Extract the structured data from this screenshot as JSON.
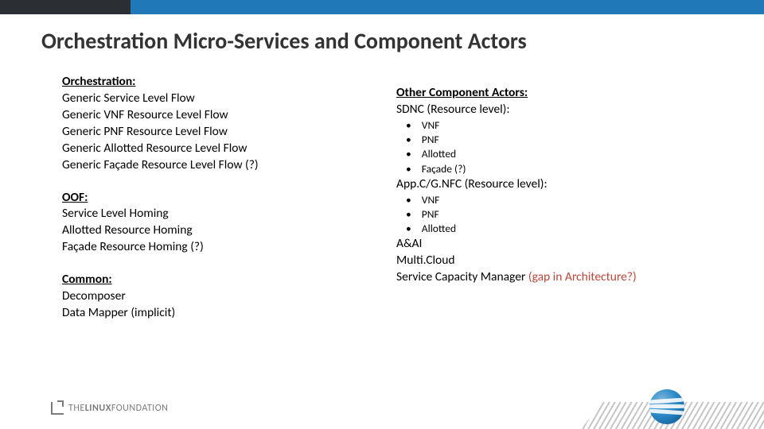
{
  "title": "Orchestration Micro-Services and Component Actors",
  "left": {
    "orch": {
      "head": "Orchestration:",
      "l1": "Generic Service Level Flow",
      "l2": "Generic VNF Resource Level Flow",
      "l3": "Generic PNF Resource Level Flow",
      "l4": "Generic Allotted Resource Level Flow",
      "l5": "Generic Façade Resource Level Flow (?)"
    },
    "oof": {
      "head": "OOF:",
      "l1": "Service Level Homing",
      "l2": "Allotted Resource Homing",
      "l3": "Façade Resource Homing (?)"
    },
    "common": {
      "head": "Common:",
      "l1": "Decomposer",
      "l2": "Data Mapper (implicit)"
    }
  },
  "right": {
    "head": "Other Component Actors:",
    "sdnc": {
      "head": "SDNC (Resource level):",
      "b1": "VNF",
      "b2": "PNF",
      "b3": "Allotted",
      "b4": "Façade (?)"
    },
    "appc": {
      "head": "App.C/G.NFC (Resource level):",
      "b1": "VNF",
      "b2": "PNF",
      "b3": "Allotted"
    },
    "aai": "A&AI",
    "mc": "Multi.Cloud",
    "scm_pre": "Service Capacity Manager ",
    "scm_gap": "(gap in Architecture?)"
  },
  "footer": {
    "lf1": "THE",
    "lf2": "LINUX",
    "lf3": "FOUNDATION"
  }
}
